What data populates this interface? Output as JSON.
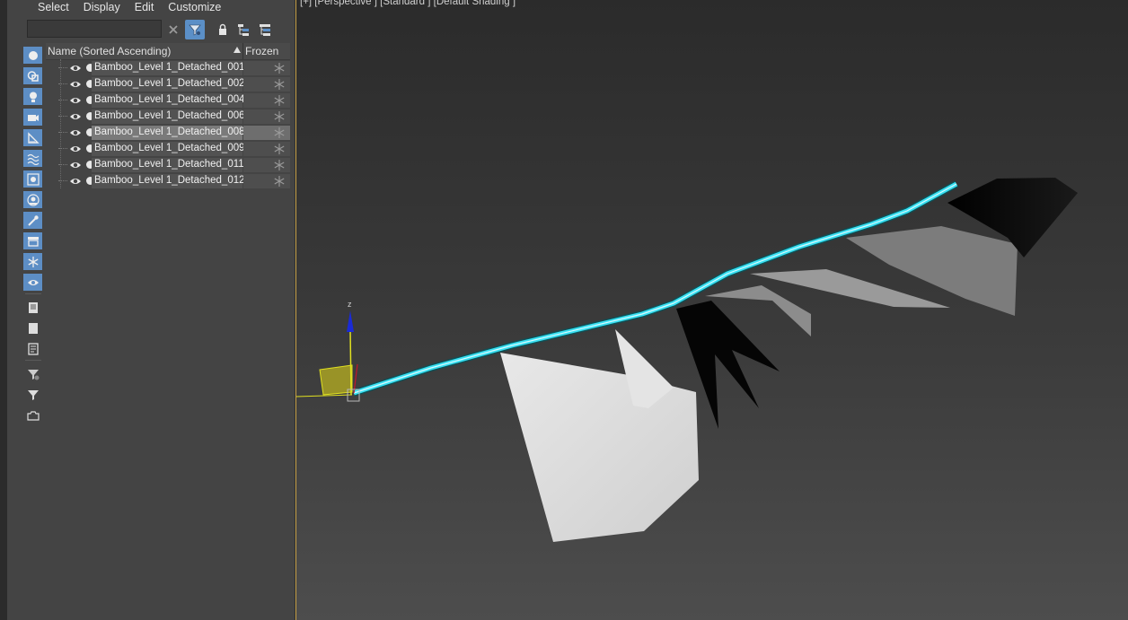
{
  "menu": [
    "Select",
    "Display",
    "Edit",
    "Customize"
  ],
  "search": {
    "value": "",
    "placeholder": ""
  },
  "table": {
    "name_header": "Name (Sorted Ascending)",
    "frozen_header": "Frozen",
    "rows": [
      {
        "name": "Bamboo_Level 1_Detached_001",
        "selected": false
      },
      {
        "name": "Bamboo_Level 1_Detached_002",
        "selected": false
      },
      {
        "name": "Bamboo_Level 1_Detached_004",
        "selected": false
      },
      {
        "name": "Bamboo_Level 1_Detached_006",
        "selected": false
      },
      {
        "name": "Bamboo_Level 1_Detached_008",
        "selected": true
      },
      {
        "name": "Bamboo_Level 1_Detached_009",
        "selected": false
      },
      {
        "name": "Bamboo_Level 1_Detached_011",
        "selected": false
      },
      {
        "name": "Bamboo_Level 1_Detached_012",
        "selected": false
      }
    ]
  },
  "viewport": {
    "label": "[+] [Perspective ] [Standard ] [Default Shading ]",
    "axis_label": "z"
  },
  "colors": {
    "accent": "#5b8fc7",
    "viewport_border": "#c8a24a",
    "selection_cyan": "#38e0f2",
    "gizmo_yellow": "#e0e020",
    "gizmo_blue": "#1a2ad6"
  },
  "icons": {
    "toolbar": [
      "clear-search-icon",
      "filter-icon",
      "lock-icon",
      "hierarchy-icon",
      "layer-hierarchy-icon"
    ],
    "sidebar": [
      "geometry-icon",
      "shapes-icon",
      "lights-icon",
      "cameras-icon",
      "helpers-icon",
      "spacewarps-icon",
      "groups-icon",
      "xrefs-icon",
      "bones-icon",
      "containers-icon",
      "frozen-icon",
      "hidden-icon",
      "display-all-icon",
      "display-none-icon",
      "invert-display-icon",
      "filter-options-icon",
      "filter-icon",
      "layer-icon"
    ]
  }
}
